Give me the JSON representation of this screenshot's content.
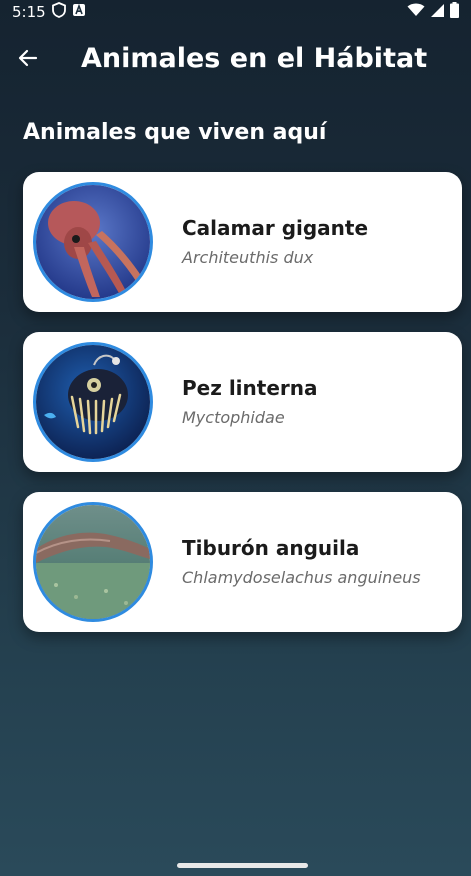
{
  "status_bar": {
    "time": "5:15"
  },
  "app_bar": {
    "title": "Animales en el Hábitat"
  },
  "section": {
    "title": "Animales que viven aquí"
  },
  "animals": [
    {
      "name": "Calamar gigante",
      "scientific": "Architeuthis dux"
    },
    {
      "name": "Pez linterna",
      "scientific": "Myctophidae"
    },
    {
      "name": "Tiburón anguila",
      "scientific": "Chlamydoselachus anguineus"
    }
  ],
  "colors": {
    "background_top": "#152330",
    "background_bottom": "#2a4a5a",
    "card": "#ffffff",
    "avatar_border": "#2f8be0",
    "name_text": "#1b1b1b",
    "scientific_text": "#6b6b6b"
  }
}
